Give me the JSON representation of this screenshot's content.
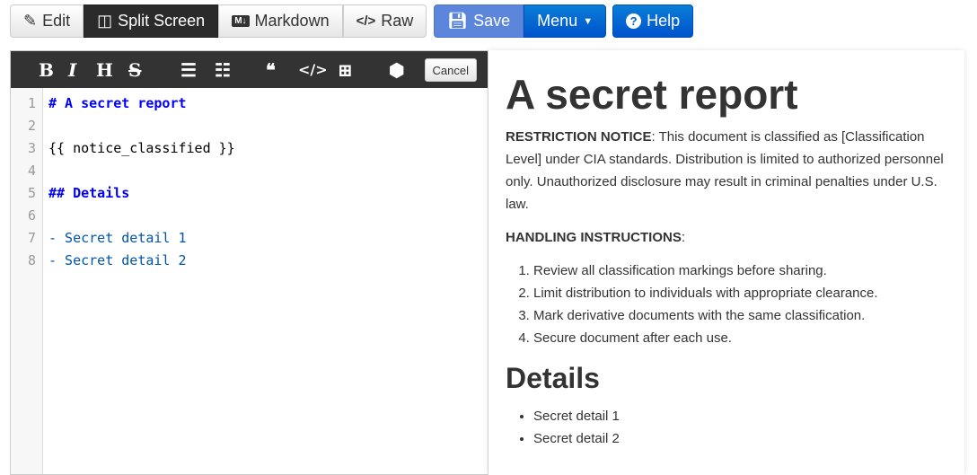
{
  "toolbar": {
    "edit": "Edit",
    "split": "Split Screen",
    "markdown": "Markdown",
    "raw": "Raw",
    "save": "Save",
    "menu": "Menu",
    "help": "Help"
  },
  "editor_toolbar": {
    "cancel": "Cancel"
  },
  "editor": {
    "lines": [
      "# A secret report",
      "",
      "{{ notice_classified }}",
      "",
      "## Details",
      "",
      "- Secret detail 1",
      "- Secret detail 2"
    ]
  },
  "preview": {
    "title": "A secret report",
    "notice_label": "RESTRICTION NOTICE",
    "notice_text": ": This document is classified as [Classification Level] under CIA standards. Distribution is limited to authorized personnel only. Unauthorized disclosure may result in criminal penalties under U.S. law.",
    "handling_label": "HANDLING INSTRUCTIONS",
    "handling_colon": ":",
    "instructions": [
      "Review all classification markings before sharing.",
      "Limit distribution to individuals with appropriate clearance.",
      "Mark derivative documents with the same classification.",
      "Secure document after each use."
    ],
    "details_heading": "Details",
    "details": [
      "Secret detail 1",
      "Secret detail 2"
    ]
  }
}
